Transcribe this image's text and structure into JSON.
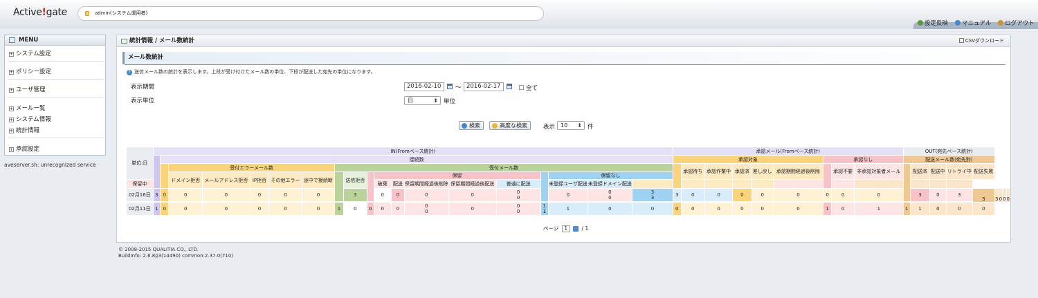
{
  "header": {
    "logo_prefix": "Active",
    "logo_mark": "!",
    "logo_suffix": "gate",
    "user": "admin(システム運用者)",
    "links": [
      {
        "label": "設定反映",
        "icon": "refresh-icon",
        "color": "#5a9a3a"
      },
      {
        "label": "マニュアル",
        "icon": "help-icon",
        "color": "#4a86c8"
      },
      {
        "label": "ログアウト",
        "icon": "logout-icon",
        "color": "#c8962a"
      }
    ]
  },
  "menu": {
    "title": "MENU",
    "items": [
      "システム設定",
      "ポリシー設定",
      "ユーザ管理",
      "メール一覧",
      "システム情報",
      "統計情報",
      "承認設定"
    ]
  },
  "server_error": "aveserver.sh: unrecognized service",
  "page": {
    "breadcrumb": "統計情報 / メール数統計",
    "csv_label": "CSVダウンロード",
    "section_title": "メール数統計",
    "description": "送信メール数の統計を表示します。上段が受け付けたメール数の単位、下段が配送した宛先の単位になります。",
    "period_label": "表示期間",
    "unit_label": "表示単位",
    "date_from": "2016-02-10",
    "date_to": "2016-02-17",
    "tilde": "～",
    "all_label": "全て",
    "unit_value": "日",
    "unit_suffix": "単位",
    "search_button": "検索",
    "advanced_search_button": "高度な検索",
    "display_label": "表示",
    "display_count": "10",
    "count_suffix": "件"
  },
  "table": {
    "h_unit": "単位:日",
    "h_in": "IN(Fromベース統計)",
    "h_approval": "承認メール(Fromベース統計)",
    "h_out": "OUT(宛先ベース統計)",
    "h_conn": "接続数",
    "h_accept": "受付メール数",
    "h_target": "承認対象",
    "h_none": "承認なし",
    "h_delivery": "配送メール数(宛先別)",
    "h_accept_err": "受付エラーメール数",
    "h_hold": "保留",
    "h_nohold": "保留なし",
    "cols": {
      "domain_reject": "ドメイン拒否",
      "addr_reject": "メールアドレス拒否",
      "ip_reject": "IP拒否",
      "other_err": "その他エラー",
      "midway_cut": "途中で接続断",
      "send_reject": "送信拒否",
      "holding": "保留中",
      "destroyed": "破棄",
      "delivered_h": "配送",
      "hold_expired_del": "保留期間経過後削除",
      "hold_expired_dlv": "保留期間経過後配送",
      "normal_dlv": "普通に配送",
      "unreg_user_dlv": "未登録ユーザ配送",
      "unreg_domain_dlv": "未登録ドメイン配送",
      "wait": "承認待ち",
      "working": "承認作業中",
      "approved": "承認済",
      "returned": "差し戻し",
      "expired_del": "承認期間経過後削除",
      "unneeded": "承認不要",
      "non_target_user": "非承認対象者メール",
      "dlv_done": "配送済",
      "dlv_ing": "配送中",
      "retry": "リトライ中",
      "dlv_fail": "配送失敗"
    },
    "rows": [
      {
        "date": "02月16日",
        "conn_total": "3",
        "err_total": "0",
        "domain_reject": "0",
        "addr_reject": "0",
        "ip_reject": "0",
        "other_err": "0",
        "midway_cut": "0",
        "acc_total": "3",
        "send_reject": "0",
        "hold_total": "0",
        "holding": "0",
        "destroyed": "0",
        "delivered_h": "0",
        "delivered_h2": "0",
        "hold_expired_del": "0",
        "hold_expired_dlv": "0",
        "hold_expired_dlv2": "0",
        "nohold_total": "3",
        "nohold_total2": "3",
        "normal_dlv": "3",
        "unreg_user_dlv": "0",
        "unreg_domain_dlv": "0",
        "target_total": "0",
        "wait": "0",
        "working": "0",
        "approved": "0",
        "returned": "0",
        "expired_del": "0",
        "none_total": "3",
        "unneeded": "0",
        "non_target_user": "3",
        "dlv_total": "3",
        "dlv_done": "3",
        "dlv_ing": "0",
        "retry": "0",
        "dlv_fail": "0"
      },
      {
        "date": "02月11日",
        "conn_total": "1",
        "err_total": "0",
        "domain_reject": "0",
        "addr_reject": "0",
        "ip_reject": "0",
        "other_err": "0",
        "midway_cut": "0",
        "acc_total": "1",
        "send_reject": "0",
        "hold_total": "0",
        "holding": "0",
        "destroyed": "0",
        "delivered_h": "0",
        "delivered_h2": "0",
        "hold_expired_del": "0",
        "hold_expired_dlv": "0",
        "hold_expired_dlv2": "0",
        "nohold_total": "1",
        "nohold_total2": "1",
        "normal_dlv": "1",
        "unreg_user_dlv": "0",
        "unreg_domain_dlv": "0",
        "target_total": "0",
        "wait": "0",
        "working": "0",
        "approved": "0",
        "returned": "0",
        "expired_del": "0",
        "none_total": "1",
        "unneeded": "0",
        "non_target_user": "1",
        "dlv_total": "1",
        "dlv_done": "1",
        "dlv_ing": "0",
        "retry": "0",
        "dlv_fail": "0"
      }
    ]
  },
  "pager": {
    "label": "ページ",
    "current": "1",
    "separator": "/",
    "total": "1"
  },
  "footer": {
    "copyright": "© 2008-2015 QUALITIA CO., LTD.",
    "build": "BuildInfo: 2.6.8p3(14490) common:2.37.0(710)"
  }
}
